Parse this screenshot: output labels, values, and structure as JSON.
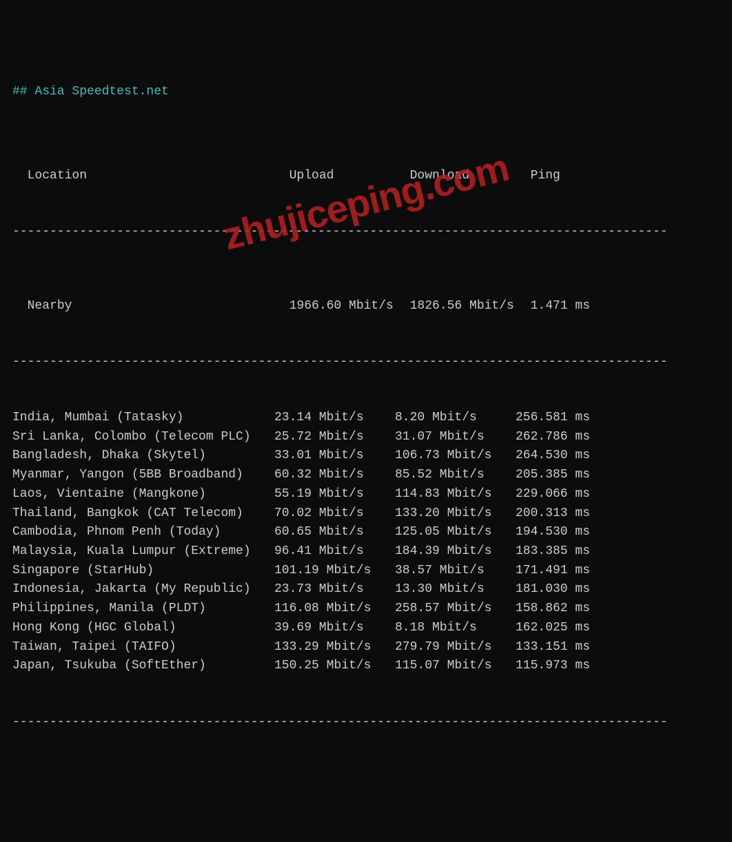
{
  "title": "## Asia Speedtest.net",
  "divider": "----------------------------------------------------------------------------------------",
  "columns": {
    "location": "Location",
    "upload": "Upload",
    "download": "Download",
    "ping": "Ping"
  },
  "nearby": {
    "location": "Nearby",
    "upload": "1966.60 Mbit/s",
    "download": "1826.56 Mbit/s",
    "ping": "1.471 ms"
  },
  "rows": [
    {
      "location": "India, Mumbai (Tatasky)",
      "upload": "23.14 Mbit/s",
      "download": "8.20 Mbit/s",
      "ping": "256.581 ms"
    },
    {
      "location": "Sri Lanka, Colombo (Telecom PLC)",
      "upload": "25.72 Mbit/s",
      "download": "31.07 Mbit/s",
      "ping": "262.786 ms"
    },
    {
      "location": "Bangladesh, Dhaka (Skytel)",
      "upload": "33.01 Mbit/s",
      "download": "106.73 Mbit/s",
      "ping": "264.530 ms"
    },
    {
      "location": "Myanmar, Yangon (5BB Broadband)",
      "upload": "60.32 Mbit/s",
      "download": "85.52 Mbit/s",
      "ping": "205.385 ms"
    },
    {
      "location": "Laos, Vientaine (Mangkone)",
      "upload": "55.19 Mbit/s",
      "download": "114.83 Mbit/s",
      "ping": "229.066 ms"
    },
    {
      "location": "Thailand, Bangkok (CAT Telecom)",
      "upload": "70.02 Mbit/s",
      "download": "133.20 Mbit/s",
      "ping": "200.313 ms"
    },
    {
      "location": "Cambodia, Phnom Penh (Today)",
      "upload": "60.65 Mbit/s",
      "download": "125.05 Mbit/s",
      "ping": "194.530 ms"
    },
    {
      "location": "Malaysia, Kuala Lumpur (Extreme)",
      "upload": "96.41 Mbit/s",
      "download": "184.39 Mbit/s",
      "ping": "183.385 ms"
    },
    {
      "location": "Singapore (StarHub)",
      "upload": "101.19 Mbit/s",
      "download": "38.57 Mbit/s",
      "ping": "171.491 ms"
    },
    {
      "location": "Indonesia, Jakarta (My Republic)",
      "upload": "23.73 Mbit/s",
      "download": "13.30 Mbit/s",
      "ping": "181.030 ms"
    },
    {
      "location": "Philippines, Manila (PLDT)",
      "upload": "116.08 Mbit/s",
      "download": "258.57 Mbit/s",
      "ping": "158.862 ms"
    },
    {
      "location": "Hong Kong (HGC Global)",
      "upload": "39.69 Mbit/s",
      "download": "8.18 Mbit/s",
      "ping": "162.025 ms"
    },
    {
      "location": "Taiwan, Taipei (TAIFO)",
      "upload": "133.29 Mbit/s",
      "download": "279.79 Mbit/s",
      "ping": "133.151 ms"
    },
    {
      "location": "Japan, Tsukuba (SoftEther)",
      "upload": "150.25 Mbit/s",
      "download": "115.07 Mbit/s",
      "ping": "115.973 ms"
    }
  ],
  "watermark": "zhujiceping.com"
}
